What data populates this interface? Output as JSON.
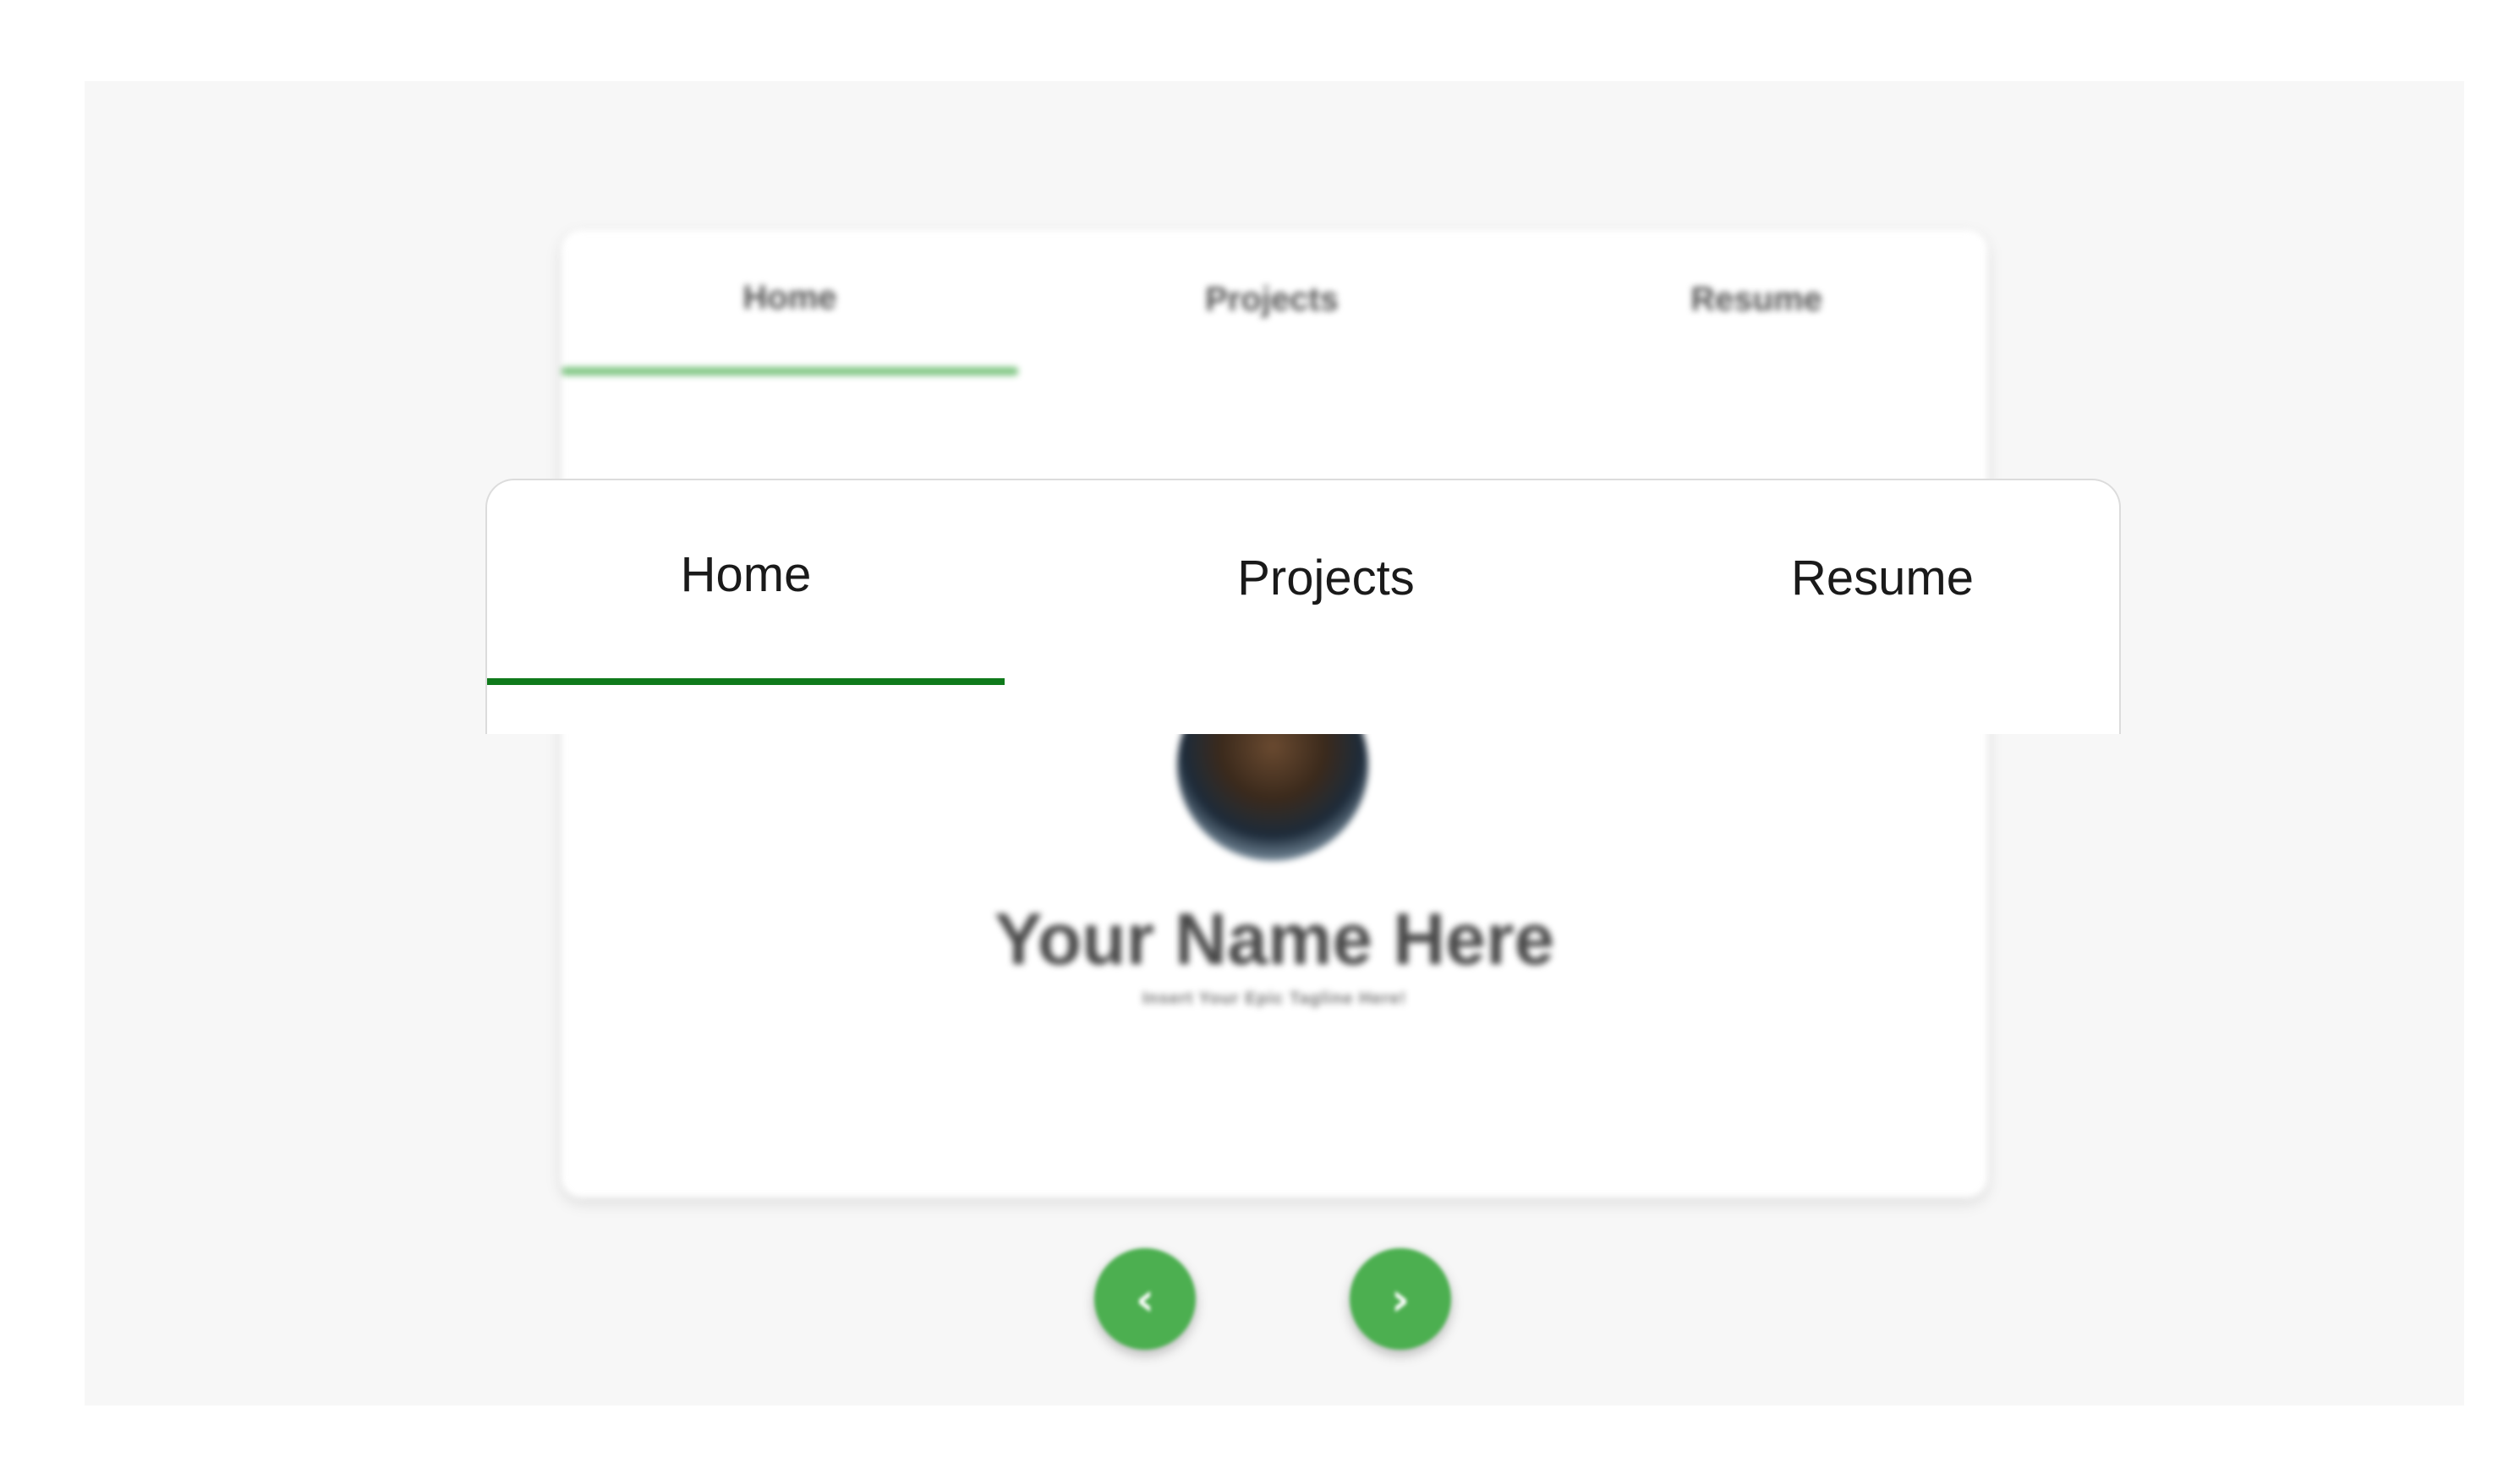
{
  "background_card": {
    "tabs": [
      {
        "label": "Home",
        "active": true
      },
      {
        "label": "Projects",
        "active": false
      },
      {
        "label": "Resume",
        "active": false
      }
    ],
    "indicator_color": "#7cc480",
    "profile": {
      "name": "Your Name Here",
      "tagline": "Insert Your Epic Tagline Here!"
    }
  },
  "navigation": {
    "prev_icon": "chevron-left-icon",
    "prev_glyph": "‹",
    "next_icon": "chevron-right-icon",
    "next_glyph": "›",
    "button_color": "#4caf50"
  },
  "zoom_nav": {
    "tabs": [
      {
        "label": "Home",
        "active": true
      },
      {
        "label": "Projects",
        "active": false
      },
      {
        "label": "Resume",
        "active": false
      }
    ],
    "indicator_color": "#0f7a1b"
  }
}
